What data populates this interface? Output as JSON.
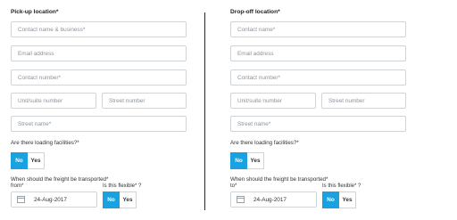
{
  "pickup": {
    "title": "Pick-up location*",
    "contact_name_placeholder": "Contact name & business*",
    "email_placeholder": "Email address",
    "contact_number_placeholder": "Contact number*",
    "unit_placeholder": "Unit/suite number",
    "street_number_placeholder": "Street number",
    "street_name_placeholder": "Street name*",
    "loading_question": "Are there loading facilities?*",
    "loading_no": "No",
    "loading_yes": "Yes",
    "when_question": "When should the freight be transported*",
    "date_label": "from*",
    "date_value": "24-Aug-2017",
    "flexible_label": "Is this flexible* ?",
    "flexible_no": "No",
    "flexible_yes": "Yes"
  },
  "dropoff": {
    "title": "Drop-off location*",
    "contact_name_placeholder": "Contact name*",
    "email_placeholder": "Email address",
    "contact_number_placeholder": "Contact number*",
    "unit_placeholder": "Unit/suite number",
    "street_number_placeholder": "Street number",
    "street_name_placeholder": "Street name*",
    "loading_question": "Are there loading facilities?*",
    "loading_no": "No",
    "loading_yes": "Yes",
    "when_question": "When should the freight be transported*",
    "date_label": "to*",
    "date_value": "24-Aug-2017",
    "flexible_label": "Is this flexible* ?",
    "flexible_no": "No",
    "flexible_yes": "Yes"
  },
  "selected": {
    "pickup_loading": "No",
    "pickup_flexible": "No",
    "dropoff_loading": "No",
    "dropoff_flexible": "No"
  },
  "colors": {
    "accent": "#1aa1e0",
    "border": "#cfd4d9",
    "divider": "#2b2b2b"
  }
}
